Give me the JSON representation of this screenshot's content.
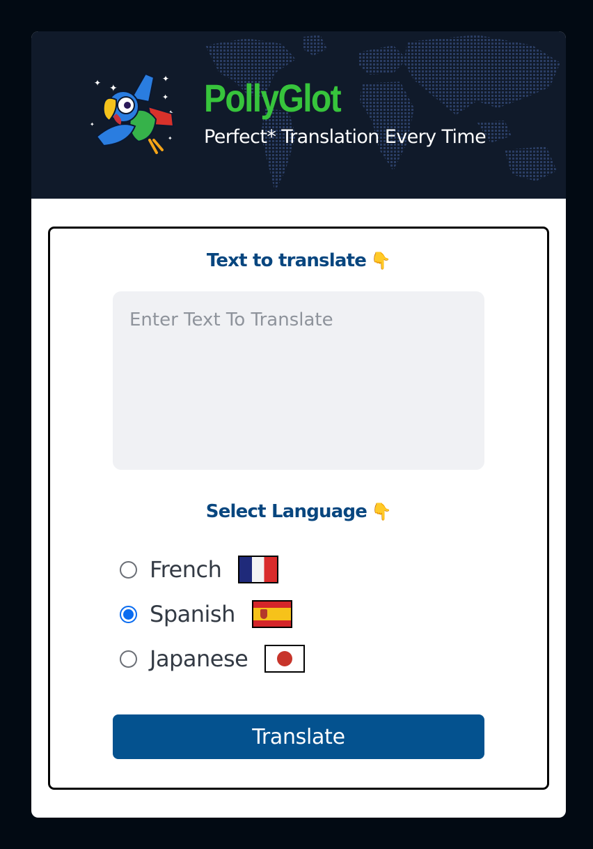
{
  "header": {
    "title": "PollyGlot",
    "subtitle": "Perfect* Translation Every Time",
    "logo_icon": "parrot-icon"
  },
  "translate_section": {
    "heading": "Text to translate",
    "heading_icon": "pointing-down-hand-icon",
    "input_placeholder": "Enter Text To Translate",
    "input_value": ""
  },
  "language_section": {
    "heading": "Select Language",
    "heading_icon": "pointing-down-hand-icon",
    "options": [
      {
        "label": "French",
        "flag": "france-flag-icon",
        "selected": false
      },
      {
        "label": "Spanish",
        "flag": "spain-flag-icon",
        "selected": true
      },
      {
        "label": "Japanese",
        "flag": "japan-flag-icon",
        "selected": false
      }
    ],
    "selected_value": "Spanish"
  },
  "actions": {
    "translate_label": "Translate"
  },
  "colors": {
    "page_bg": "#020a13",
    "header_bg": "#101a2a",
    "brand_green": "#37c43c",
    "heading_blue": "#08467f",
    "button_blue": "#04528f",
    "radio_selected": "#0a6cf0"
  }
}
